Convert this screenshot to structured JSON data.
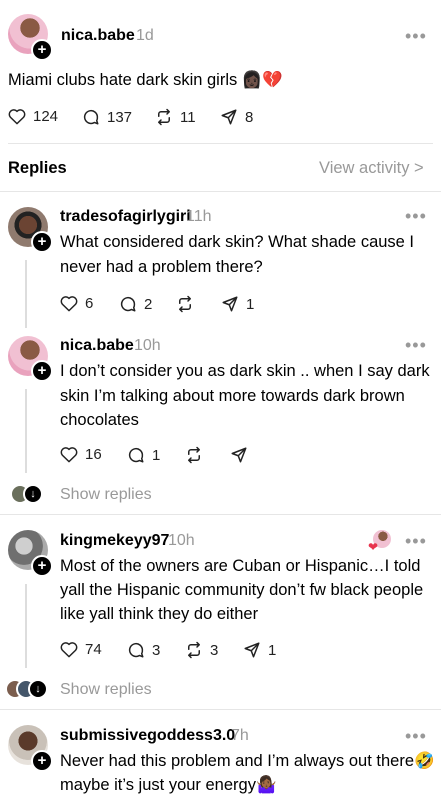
{
  "post": {
    "username": "nica.babe",
    "time": "1d",
    "text": "Miami clubs hate dark skin girls 👩🏿💔",
    "likes": "124",
    "comments": "137",
    "reposts": "11",
    "shares": "8"
  },
  "replies_header": {
    "label": "Replies",
    "view_activity": "View activity >"
  },
  "replies": [
    {
      "username": "tradesofagirlygirl",
      "time": "11h",
      "line1": "What considered dark skin? What shade cause I",
      "line2": "never had a problem there?",
      "likes": "6",
      "comments": "2",
      "shares": "1"
    },
    {
      "username": "nica.babe",
      "time": "10h",
      "line1": "I don’t consider you as dark skin .. when I say dark",
      "line2": "skin I’m talking about more towards dark brown",
      "line3": "chocolates",
      "likes": "16",
      "comments": "1",
      "show_replies": "Show replies"
    },
    {
      "username": "kingmekeyy97",
      "time": "10h",
      "line1": "Most of the owners are Cuban or Hispanic…I told",
      "line2": "yall the Hispanic community don’t fw black people",
      "line3": "like yall think they do either",
      "likes": "74",
      "comments": "3",
      "reposts": "3",
      "shares": "1",
      "show_replies": "Show replies"
    },
    {
      "username": "submissivegoddess3.0",
      "time": "7h",
      "line1": "Never had this problem and I’m always out there🤣",
      "line2": "maybe it’s just your energy🤷🏾‍♀️"
    }
  ],
  "colors": {
    "text": "#000000",
    "muted": "#999999",
    "divider": "#e6e6e6",
    "heart_accent": "#e8344e"
  }
}
